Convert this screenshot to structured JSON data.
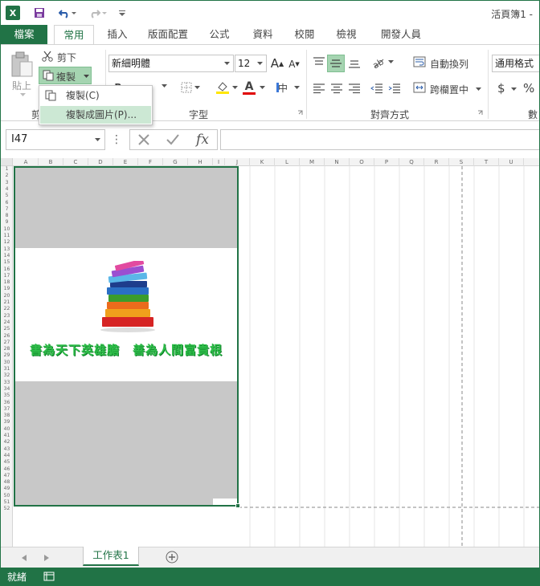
{
  "titlebar": {
    "doc_title": "活頁簿1 -",
    "app_icon_letter": "X",
    "undo_icon": "undo-icon",
    "redo_icon": "redo-icon"
  },
  "tabs": [
    "檔案",
    "常用",
    "插入",
    "版面配置",
    "公式",
    "資料",
    "校閱",
    "檢視",
    "開發人員"
  ],
  "ribbon": {
    "clipboard": {
      "paste_label": "貼上",
      "cut_label": "剪下",
      "copy_label": "複製",
      "group_label": "剪"
    },
    "font": {
      "font_name": "新細明體",
      "font_size": "12",
      "grow_label": "A",
      "shrink_label": "A",
      "font_color_label": "A",
      "group_label": "字型"
    },
    "alignment": {
      "wrap_label": "自動換列",
      "merge_label": "跨欄置中",
      "group_label": "對齊方式"
    },
    "number": {
      "format_value": "通用格式",
      "currency_label": "$",
      "percent_label": "%",
      "group_label": "數"
    }
  },
  "copy_menu": {
    "items": [
      "複製(C)",
      "複製成圖片(P)..."
    ]
  },
  "formula_bar": {
    "name_box": "I47",
    "fx_label": "fx",
    "formula_value": ""
  },
  "grid": {
    "columns": [
      "A",
      "B",
      "C",
      "D",
      "E",
      "F",
      "G",
      "H",
      "I",
      "J",
      "K",
      "L",
      "M",
      "N",
      "O",
      "P",
      "Q",
      "R",
      "S",
      "T",
      "U"
    ],
    "rows": [
      "1",
      "2",
      "3",
      "4",
      "5",
      "6",
      "7",
      "8",
      "9",
      "10",
      "11",
      "12",
      "13",
      "14",
      "15",
      "16",
      "17",
      "18",
      "19",
      "20",
      "21",
      "22",
      "23",
      "24",
      "25",
      "26",
      "27",
      "28",
      "29",
      "30",
      "31",
      "32",
      "33",
      "34",
      "35",
      "36",
      "37",
      "38",
      "39",
      "40",
      "41",
      "42",
      "43",
      "44",
      "45",
      "46",
      "47",
      "48",
      "49",
      "50",
      "51",
      "52"
    ],
    "image_caption": "書為天下英雄膽　善為人間富貴根"
  },
  "sheet_tabs": {
    "active": "工作表1",
    "add_icon": "add-sheet-icon"
  },
  "status": {
    "ready": "就緒"
  },
  "colors": {
    "accent": "#217346",
    "highlight": "#cce8d4",
    "caption_green": "#2fbf4a"
  }
}
